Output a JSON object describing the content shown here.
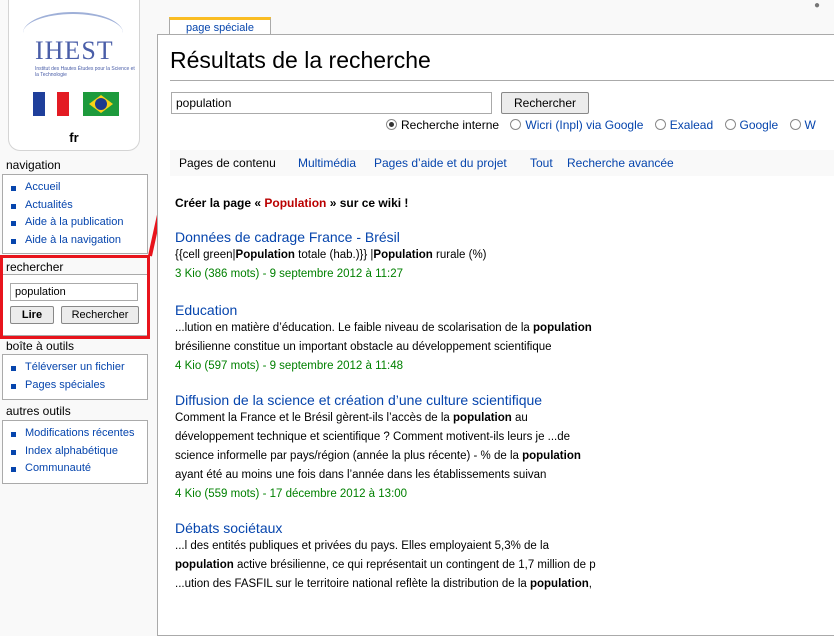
{
  "logo": {
    "text": "IHEST",
    "subtitle": "Institut des Hautes Études pour la Science et la Technologie",
    "lang": "fr"
  },
  "colors": {
    "link": "#0645ad",
    "new_link": "#ba0000",
    "meta": "#008000",
    "highlight": "#e8141c"
  },
  "sidebar": {
    "navigation": {
      "title": "navigation",
      "items": [
        {
          "label": "Accueil"
        },
        {
          "label": "Actualités"
        },
        {
          "label": "Aide à la publication"
        },
        {
          "label": "Aide à la navigation"
        }
      ]
    },
    "search": {
      "title": "rechercher",
      "value": "population",
      "go_label": "Lire",
      "search_label": "Rechercher"
    },
    "toolbox": {
      "title": "boîte à outils",
      "items": [
        {
          "label": "Téléverser un fichier"
        },
        {
          "label": "Pages spéciales"
        }
      ]
    },
    "other_tools": {
      "title": "autres outils",
      "items": [
        {
          "label": "Modifications récentes"
        },
        {
          "label": "Index alphabétique"
        },
        {
          "label": "Communauté"
        }
      ]
    }
  },
  "tab": {
    "label": "page spéciale"
  },
  "page": {
    "title": "Résultats de la recherche",
    "search_value": "population",
    "search_button": "Rechercher",
    "options": [
      {
        "label": "Recherche interne",
        "selected": true
      },
      {
        "label": "Wicri (Inpl) via Google",
        "selected": false
      },
      {
        "label": "Exalead",
        "selected": false
      },
      {
        "label": "Google",
        "selected": false
      },
      {
        "label": "W",
        "selected": false
      }
    ],
    "filters": [
      "Pages de contenu",
      "Multimédia",
      "Pages d’aide et du projet",
      "Tout",
      "Recherche avancée"
    ],
    "create": {
      "prefix": "Créer la page « ",
      "page_name": "Population",
      "suffix": " » sur ce wiki !"
    }
  },
  "results": [
    {
      "title": "Données de cadrage France - Brésil",
      "snippet": [
        [
          {
            "t": "{{cell green|"
          },
          {
            "t": "Population",
            "b": true
          },
          {
            "t": " totale (hab.)}} |"
          },
          {
            "t": "Population",
            "b": true
          },
          {
            "t": " rurale (%)"
          }
        ]
      ],
      "meta": "3 Kio (386 mots) - 9 septembre 2012 à 11:27"
    },
    {
      "title": "Education",
      "snippet": [
        [
          {
            "t": "...lution en matière d’éducation. Le faible niveau de scolarisation de la "
          },
          {
            "t": "population",
            "b": true
          }
        ],
        [
          {
            "t": "brésilienne constitue un important obstacle au développement scientifique"
          }
        ]
      ],
      "meta": "4 Kio (597 mots) - 9 septembre 2012 à 11:48"
    },
    {
      "title": "Diffusion de la science et création d’une culture scientifique",
      "snippet": [
        [
          {
            "t": "Comment la France et le Brésil gèrent-ils l’accès de la "
          },
          {
            "t": "population",
            "b": true
          },
          {
            "t": " au"
          }
        ],
        [
          {
            "t": "développement technique et scientifique ? Comment motivent-ils leurs je ...de"
          }
        ],
        [
          {
            "t": "science informelle par pays/région (année la plus récente) - % de la "
          },
          {
            "t": "population",
            "b": true
          }
        ],
        [
          {
            "t": "ayant été au moins une fois dans l’année dans les établissements suivan"
          }
        ]
      ],
      "meta": "4 Kio (559 mots) - 17 décembre 2012 à 13:00"
    },
    {
      "title": "Débats sociétaux",
      "snippet": [
        [
          {
            "t": "...l des entités publiques et privées du pays. Elles employaient 5,3% de la"
          }
        ],
        [
          {
            "t": "population",
            "b": true
          },
          {
            "t": " active brésilienne, ce qui représentait un contingent de 1,7 million de p"
          }
        ],
        [
          {
            "t": "...ution des FASFIL sur le territoire national reflète la distribution de la "
          },
          {
            "t": "population",
            "b": true
          },
          {
            "t": ","
          }
        ]
      ],
      "meta": ""
    }
  ]
}
